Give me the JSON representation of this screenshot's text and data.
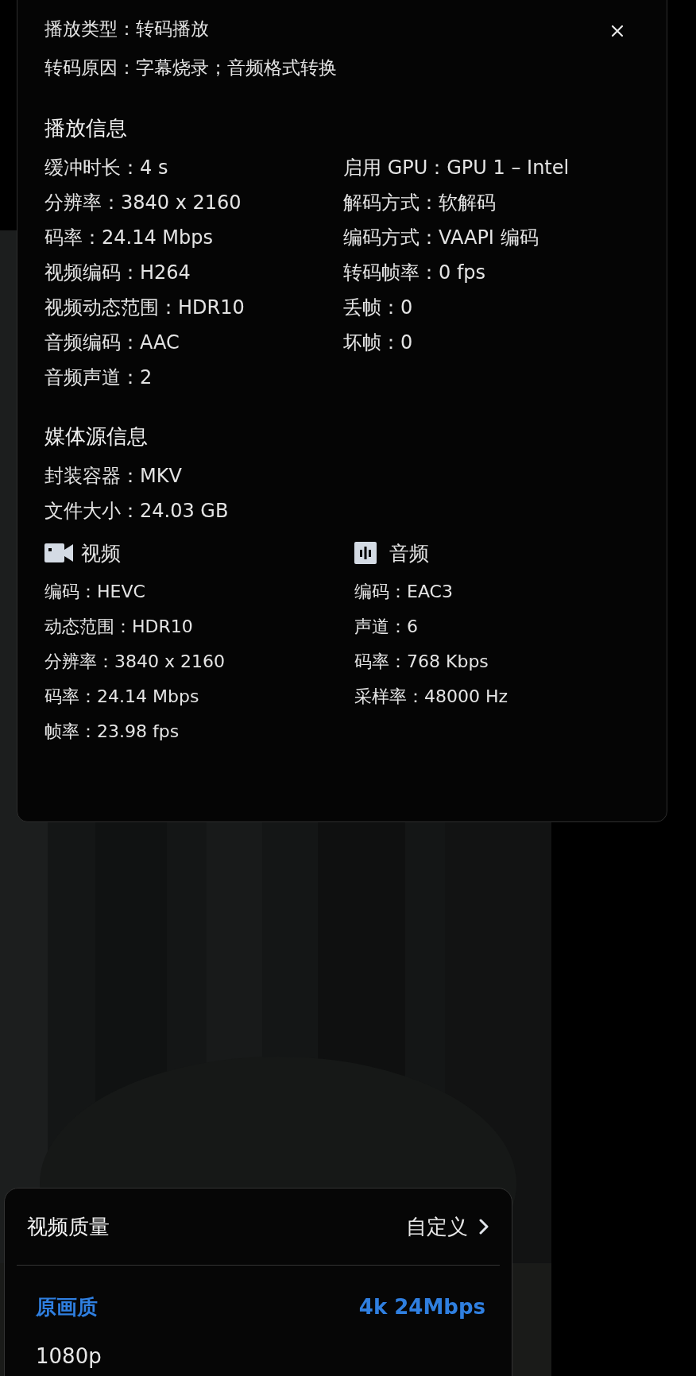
{
  "transcode": [
    "播放类型：转码播放",
    "转码原因：字幕烧录；音频格式转换"
  ],
  "playback": {
    "title": "播放信息",
    "left": [
      "缓冲时长：4 s",
      "分辨率：3840 x 2160",
      "码率：24.14 Mbps",
      "视频编码：H264",
      "视频动态范围：HDR10",
      "音频编码：AAC",
      "音频声道：2"
    ],
    "right": [
      "启用 GPU：GPU 1 – Intel",
      "解码方式：软解码",
      "编码方式：VAAPI 编码",
      "转码帧率：0 fps",
      "丢帧：0",
      "坏帧：0"
    ]
  },
  "media": {
    "title": "媒体源信息",
    "items": [
      "封装容器：MKV",
      "文件大小：24.03 GB"
    ],
    "streams": [
      {
        "kind": "video",
        "title": "视频",
        "items": [
          "编码：HEVC",
          "动态范围：HDR10",
          "分辨率：3840 x 2160",
          "码率：24.14 Mbps",
          "帧率：23.98 fps"
        ]
      },
      {
        "kind": "audio",
        "title": "音频",
        "items": [
          "编码：EAC3",
          "声道：6",
          "码率：768 Kbps",
          "采样率：48000 Hz"
        ]
      }
    ]
  },
  "quality": {
    "title": "视频质量",
    "custom": "自定义",
    "options": [
      {
        "label": "原画质",
        "detail": "4k 24Mbps",
        "selected": true
      },
      {
        "label": "1080p",
        "selected": false
      }
    ]
  }
}
